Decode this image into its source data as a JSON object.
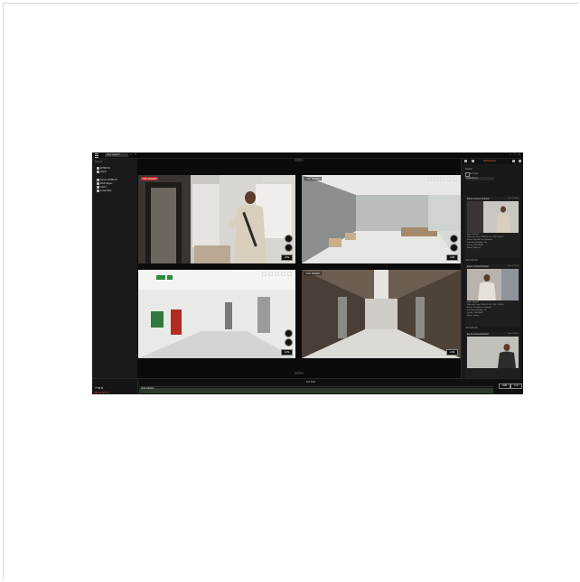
{
  "window": {
    "tab_title": "New Layout*",
    "tab_close": "×",
    "tab_add": "+",
    "controls": [
      "–",
      "□",
      "×"
    ]
  },
  "sidebar": {
    "search_placeholder": "Search",
    "items": [
      {
        "label": "WTB1TU",
        "icon": "server-icon"
      },
      {
        "label": "admin",
        "icon": "user-icon"
      },
      {
        "label": "Server WTB1TU",
        "icon": "server-icon"
      },
      {
        "label": "Web Pages",
        "icon": "globe-icon"
      },
      {
        "label": "Users",
        "icon": "users-icon"
      },
      {
        "label": "Local Files",
        "icon": "folder-icon"
      }
    ]
  },
  "cameras": [
    {
      "name": "XND-6081RV",
      "recording": true
    },
    {
      "name": "XND-6081RV",
      "recording": false
    },
    {
      "name": "",
      "recording": false
    },
    {
      "name": "XNO-6081RV",
      "recording": false
    }
  ],
  "live_label": "LIVE",
  "right_panel": {
    "tab_label": "Notifications",
    "search_label": "Search",
    "filter_label": "Any Type",
    "select_label": "Notifications",
    "events": [
      {
        "title": "Event: Access Granted",
        "date": "Feb 1 15:00",
        "lines": [
          "Type: Normal",
          "Date and Time: 2024-11-10 · PM: 1:34:47",
          "Event: Door Access Granted",
          "Location: Building · 01",
          "Device: XNV-6081",
          "Name: Michael",
          "Card Number: 20000012"
        ],
        "section": "XND-6081RV"
      },
      {
        "title": "Event: Access Normal",
        "date": "Feb 1 15:00",
        "lines": [
          "Type: Normal",
          "Date and Time: 2024-11-10 · PM: 1:34:40",
          "Event: Door Access Normal",
          "Location: Building · 01",
          "Device: XNV-6081",
          "Name: James",
          "Card Number: 20000118"
        ],
        "section": "XNO-6081RV"
      },
      {
        "title": "Event: Access Normal",
        "date": "Feb 1 15:00",
        "lines": [],
        "section": ""
      }
    ]
  },
  "timeline": {
    "camera_label": "XND-6081RV",
    "date_label": "Feb 2024",
    "clock": "AM 10:56:37",
    "live_label": "LIVE",
    "zoom_label": "1 Min"
  },
  "colors": {
    "accent": "#e06a3a",
    "record": "#c41e1e",
    "timeline_bar": "#2c3a2c"
  }
}
